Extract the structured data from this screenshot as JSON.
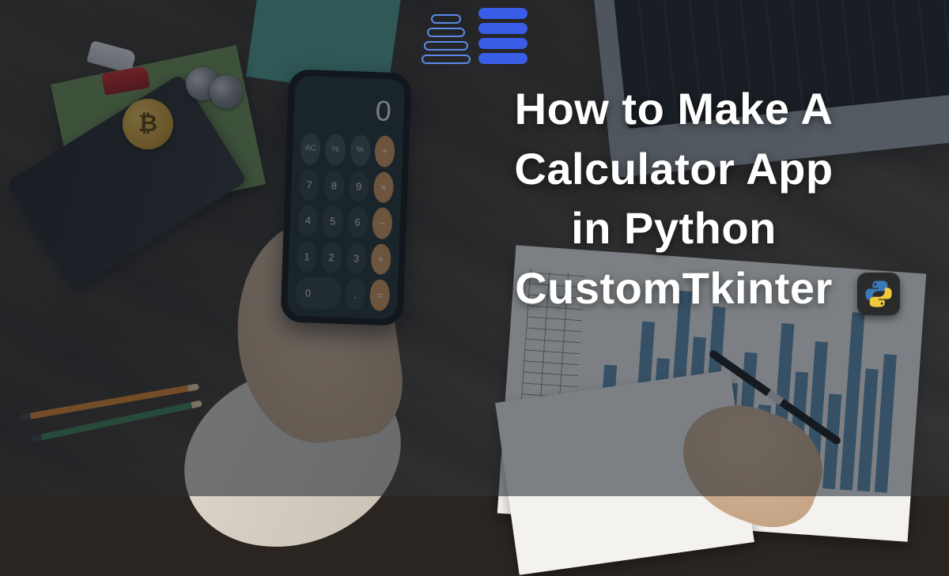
{
  "headline": {
    "line1": "How to Make A",
    "line2": "Calculator App",
    "line3": "in Python",
    "line4": "CustomTkinter"
  },
  "calculator": {
    "display": "0",
    "buttons": [
      {
        "label": "AC",
        "cls": "fn"
      },
      {
        "label": "%",
        "cls": "fn"
      },
      {
        "label": "%",
        "cls": "fn"
      },
      {
        "label": "÷",
        "cls": "op"
      },
      {
        "label": "7",
        "cls": "num"
      },
      {
        "label": "8",
        "cls": "num"
      },
      {
        "label": "9",
        "cls": "num"
      },
      {
        "label": "×",
        "cls": "op"
      },
      {
        "label": "4",
        "cls": "num"
      },
      {
        "label": "5",
        "cls": "num"
      },
      {
        "label": "6",
        "cls": "num"
      },
      {
        "label": "−",
        "cls": "op"
      },
      {
        "label": "1",
        "cls": "num"
      },
      {
        "label": "2",
        "cls": "num"
      },
      {
        "label": "3",
        "cls": "num"
      },
      {
        "label": "+",
        "cls": "op"
      },
      {
        "label": "0",
        "cls": "num zero"
      },
      {
        "label": ".",
        "cls": "num"
      },
      {
        "label": "=",
        "cls": "op"
      }
    ]
  },
  "icons": {
    "bitcoin_symbol": "₿",
    "python_label": "python-icon"
  },
  "chart_bar_heights_pct": [
    35,
    55,
    42,
    78,
    60,
    95,
    72,
    88,
    50,
    66,
    40,
    82,
    58,
    74,
    48,
    90,
    62,
    70
  ]
}
